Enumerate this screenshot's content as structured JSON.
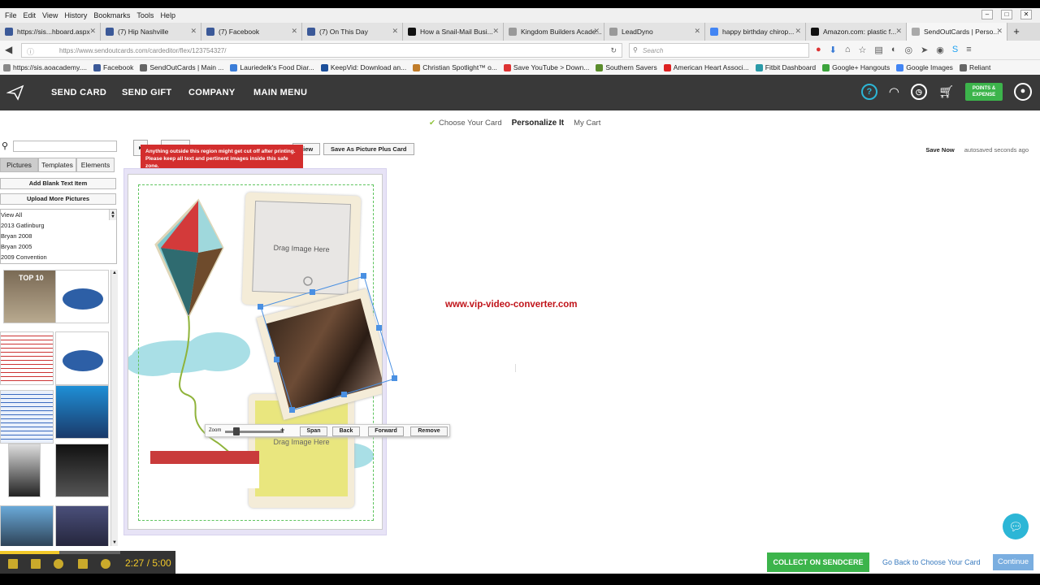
{
  "browser": {
    "menu": [
      "File",
      "Edit",
      "View",
      "History",
      "Bookmarks",
      "Tools",
      "Help"
    ],
    "tabs": [
      {
        "label": "https://sis...hboard.aspx",
        "color": "#3b5998"
      },
      {
        "label": "(7) Hip Nashville",
        "color": "#3b5998"
      },
      {
        "label": "(7) Facebook",
        "color": "#3b5998"
      },
      {
        "label": "(7) On This Day",
        "color": "#3b5998"
      },
      {
        "label": "How a Snail-Mail Busi...",
        "color": "#111"
      },
      {
        "label": "Kingdom Builders Acade...",
        "color": "#999"
      },
      {
        "label": "LeadDyno",
        "color": "#999"
      },
      {
        "label": "happy birthday chirop...",
        "color": "#4285f4"
      },
      {
        "label": "Amazon.com: plastic f...",
        "color": "#111"
      },
      {
        "label": "SendOutCards | Perso...",
        "color": "#aaa"
      }
    ],
    "url": "https://www.sendoutcards.com/cardeditor/flex/123754327/",
    "search_placeholder": "Search",
    "bookmarks": [
      {
        "label": "https://sis.aoacademy....",
        "color": "#888"
      },
      {
        "label": "Facebook",
        "color": "#3b5998"
      },
      {
        "label": "SendOutCards | Main ...",
        "color": "#666"
      },
      {
        "label": "Lauriedelk's Food Diar...",
        "color": "#3b7dd8"
      },
      {
        "label": "KeepVid: Download an...",
        "color": "#1c4f9a"
      },
      {
        "label": "Christian Spotlight™ o...",
        "color": "#c07c2a"
      },
      {
        "label": "Save YouTube > Down...",
        "color": "#d33"
      },
      {
        "label": "Southern Savers",
        "color": "#5a8c2c"
      },
      {
        "label": "American Heart Associ...",
        "color": "#d22"
      },
      {
        "label": "Fitbit Dashboard",
        "color": "#2a9aa8"
      },
      {
        "label": "Google+ Hangouts",
        "color": "#3ca43c"
      },
      {
        "label": "Google Images",
        "color": "#4285f4"
      },
      {
        "label": "Reliant",
        "color": "#666"
      }
    ]
  },
  "site": {
    "nav": [
      "SEND CARD",
      "SEND GIFT",
      "COMPANY",
      "MAIN MENU"
    ],
    "points_label": "POINTS & EXPENSE",
    "help_icon": "?"
  },
  "steps": {
    "choose": "Choose Your Card",
    "personalize": "Personalize It",
    "cart": "My Cart"
  },
  "panel": {
    "tabs": [
      "Pictures",
      "Templates",
      "Elements"
    ],
    "add_text": "Add Blank Text Item",
    "upload": "Upload More Pictures",
    "albums": [
      "View All",
      "2013 Gatlinburg",
      "Bryan 2008",
      "Bryan 2005",
      "2009 Convention"
    ],
    "thumb_top10": "TOP 10"
  },
  "editor": {
    "preview_btn": "view",
    "save_picture": "Save As Picture Plus Card",
    "warning": "Anything outside this region might get cut off after printing. Please keep all text and pertinent images inside this safe zone.",
    "save_now": "Save Now",
    "autosaved": "autosaved seconds ago",
    "drag1": "Drag Image Here",
    "drag2": "Drag Image Here"
  },
  "zoomtool": {
    "zoom": "Zoom",
    "span": "Span",
    "back": "Back",
    "forward": "Forward",
    "remove": "Remove"
  },
  "watermark": "www.vip-video-converter.com",
  "footer": {
    "collect": "COLLECT ON SENDCERE",
    "goback": "Go Back to Choose Your Card",
    "continue": "Continue"
  },
  "video": {
    "time": "2:27 / 5:00",
    "progress": 0.49
  }
}
